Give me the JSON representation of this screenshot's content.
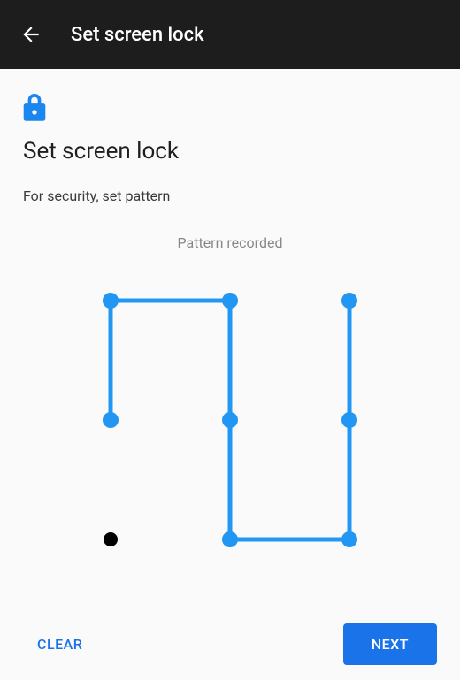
{
  "header": {
    "title": "Set screen lock"
  },
  "content": {
    "page_title": "Set screen lock",
    "subtitle": "For security, set pattern",
    "status": "Pattern recorded"
  },
  "pattern": {
    "grid_size": 3,
    "dots": [
      {
        "id": 0,
        "row": 0,
        "col": 0,
        "selected": true
      },
      {
        "id": 1,
        "row": 0,
        "col": 1,
        "selected": true
      },
      {
        "id": 2,
        "row": 0,
        "col": 2,
        "selected": true
      },
      {
        "id": 3,
        "row": 1,
        "col": 0,
        "selected": true
      },
      {
        "id": 4,
        "row": 1,
        "col": 1,
        "selected": true
      },
      {
        "id": 5,
        "row": 1,
        "col": 2,
        "selected": true
      },
      {
        "id": 6,
        "row": 2,
        "col": 0,
        "selected": false
      },
      {
        "id": 7,
        "row": 2,
        "col": 1,
        "selected": true
      },
      {
        "id": 8,
        "row": 2,
        "col": 2,
        "selected": true
      }
    ],
    "path": [
      3,
      0,
      1,
      4,
      7,
      8,
      5,
      2
    ],
    "colors": {
      "selected": "#2196f3",
      "unselected": "#000000",
      "line": "#2196f3"
    }
  },
  "footer": {
    "clear_label": "CLEAR",
    "next_label": "NEXT"
  }
}
